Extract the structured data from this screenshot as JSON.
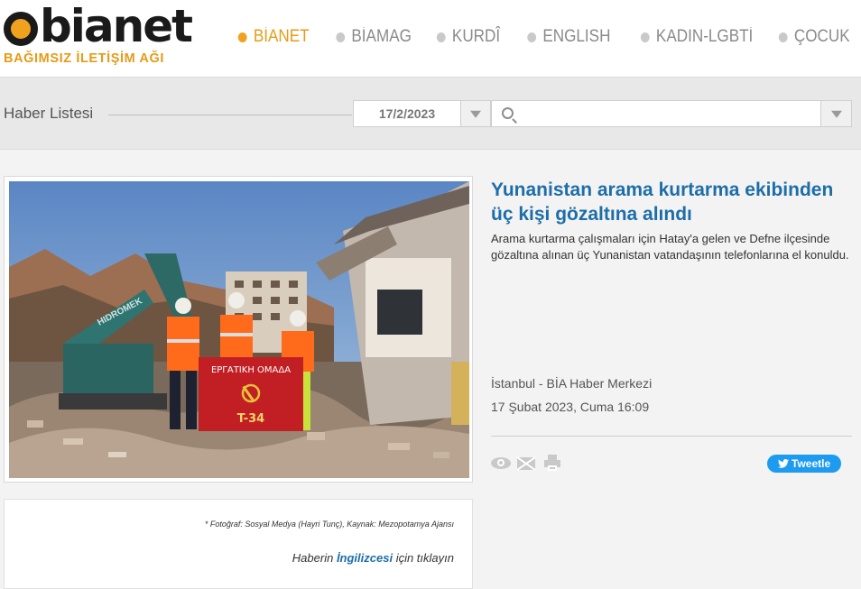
{
  "brand": {
    "logo_word": "bianet",
    "tagline": "BAĞIMSIZ İLETİŞİM AĞI"
  },
  "nav": [
    {
      "label": "BİANET",
      "active": true
    },
    {
      "label": "BİAMAG",
      "active": false
    },
    {
      "label": "KURDÎ",
      "active": false
    },
    {
      "label": "ENGLISH",
      "active": false
    },
    {
      "label": "KADIN-LGBTİ",
      "active": false
    },
    {
      "label": "ÇOCUK",
      "active": false
    }
  ],
  "filter": {
    "title": "Haber Listesi",
    "date": "17/2/2023",
    "search_value": ""
  },
  "photo": {
    "banner_text": "ΕΡΓΑΤΙΚΗ ΟΜΑΔΑ",
    "banner_code": "T-34",
    "excavator_brand": "HIDROMEK"
  },
  "article": {
    "title": "Yunanistan arama kurtarma ekibinden üç kişi gözaltına alındı",
    "summary": "Arama kurtarma çalışmaları için Hatay'a gelen ve Defne ilçesinde gözaltına alınan üç Yunanistan vatandaşının telefonlarına el konuldu.",
    "source": "İstanbul - BİA Haber Merkezi",
    "date": "17 Şubat 2023, Cuma 16:09",
    "tweet_label": "Tweetle"
  },
  "caption": {
    "text": "* Fotoğraf: Sosyal Medya (Hayri Tunç), Kaynak: Mezopotamya Ajansı",
    "link_prefix": "Haberin ",
    "link_text": "İngilizcesi",
    "link_suffix": " için tıklayın"
  },
  "colors": {
    "accent": "#f0a21f",
    "title_blue": "#1d6ea8",
    "twitter": "#1d9bf0"
  }
}
